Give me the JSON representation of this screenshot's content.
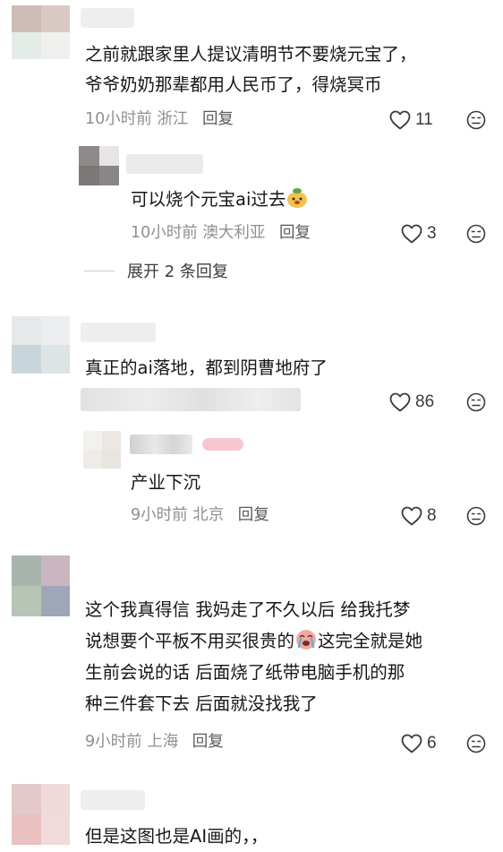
{
  "comments": [
    {
      "text_lines": [
        "之前就跟家里人提议清明节不要烧元宝了，",
        "爷爷奶奶那辈都用人民币了，得烧冥币"
      ],
      "time": "10小时前",
      "location": "浙江",
      "reply_label": "回复",
      "likes": "11",
      "replies": [
        {
          "text": "可以烧个元宝ai过去",
          "emoji": "moneybag-dog-emoji",
          "time": "10小时前",
          "location": "澳大利亚",
          "reply_label": "回复",
          "likes": "3"
        }
      ],
      "expand_label": "展开 2 条回复"
    },
    {
      "text_lines": [
        "真正的ai落地，都到阴曹地府了"
      ],
      "likes": "86",
      "replies": [
        {
          "text": "产业下沉",
          "time": "9小时前",
          "location": "北京",
          "reply_label": "回复",
          "likes": "8"
        }
      ]
    },
    {
      "text_lines": [
        "这个我真得信 我妈走了不久以后 给我托梦",
        "说想要个平板不用买很贵的",
        "这完全就是她",
        "生前会说的话 后面烧了纸带电脑手机的那",
        "种三件套下去 后面就没找我了"
      ],
      "emoji": "crying-emoji",
      "time": "9小时前",
      "location": "上海",
      "reply_label": "回复",
      "likes": "6"
    },
    {
      "text_lines": [
        "但是这图也是AI画的，，"
      ]
    }
  ],
  "colors": {
    "text": "#161616",
    "meta": "#8f8f8f",
    "icon": "#3a3a3a"
  },
  "icons": [
    "heart-icon",
    "dislike-face-icon"
  ]
}
